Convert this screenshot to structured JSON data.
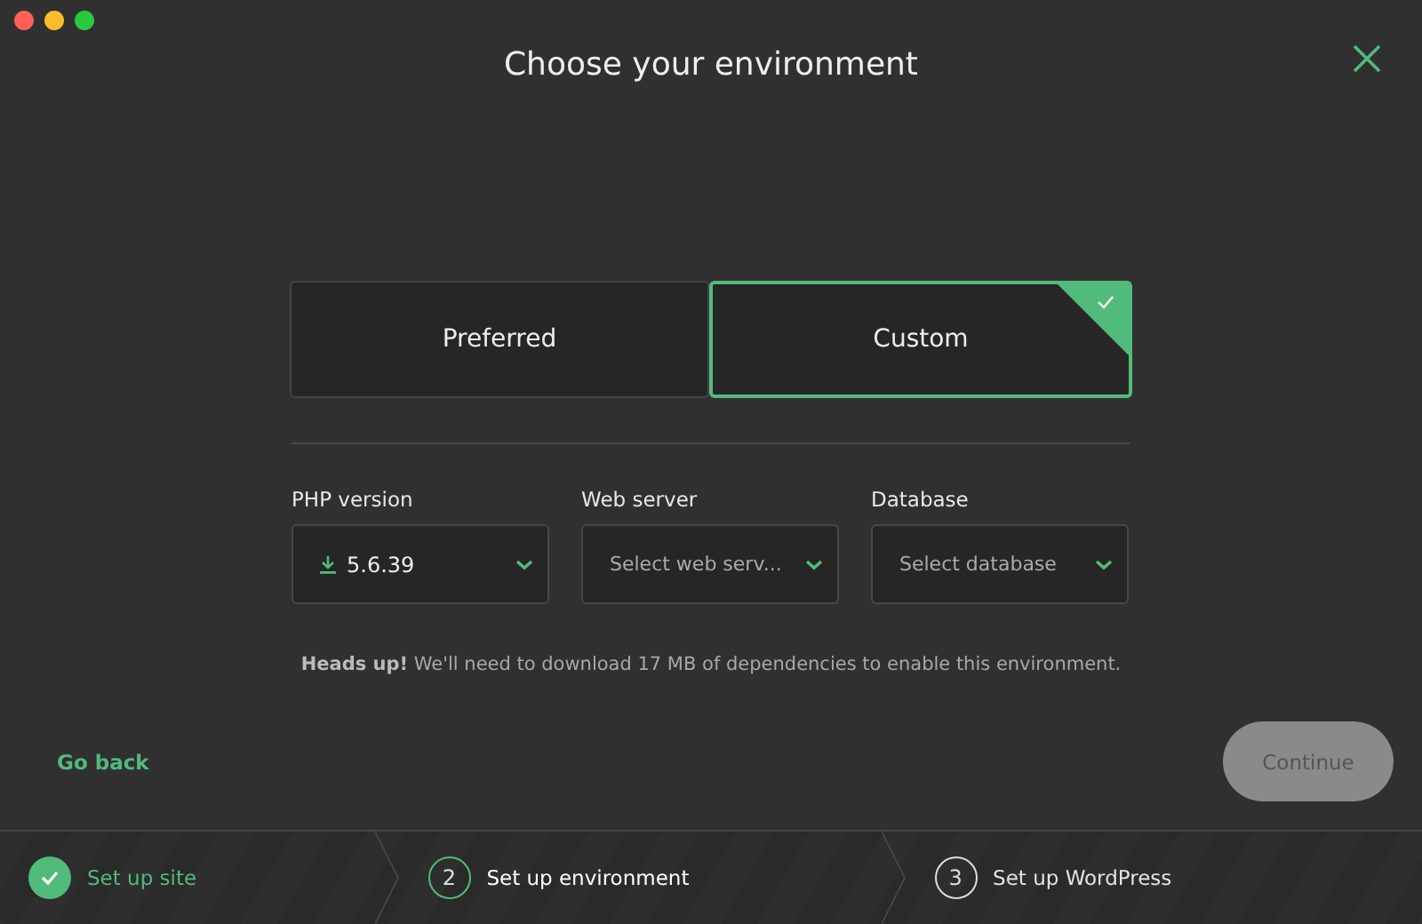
{
  "window": {
    "title": "Choose your environment"
  },
  "options": [
    {
      "label": "Preferred",
      "selected": false
    },
    {
      "label": "Custom",
      "selected": true
    }
  ],
  "selects": [
    {
      "label": "PHP version",
      "value": "5.6.39",
      "downloadable": true
    },
    {
      "label": "Web server",
      "placeholder": "Select web serv..."
    },
    {
      "label": "Database",
      "placeholder": "Select database"
    }
  ],
  "notice": "**Heads up!** We'll need to download 17 MB of dependencies to enable this environment.",
  "back_link": "Go back",
  "continue_button": {
    "label": "Continue",
    "disabled": true
  },
  "steps": [
    {
      "label": "Set up site",
      "completed": true,
      "selected": false
    },
    {
      "number": "2",
      "label": "Set up environment",
      "completed": false,
      "selected": true
    },
    {
      "number": "3",
      "label": "Set up WordPress",
      "completed": false,
      "selected": false
    }
  ]
}
